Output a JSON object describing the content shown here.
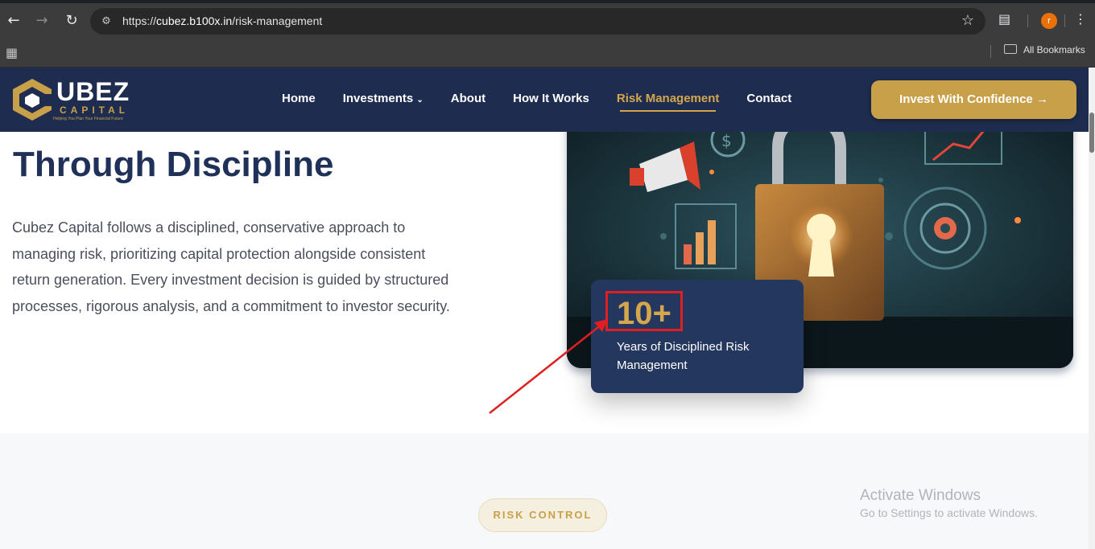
{
  "browser": {
    "url_prefix": "https://",
    "url_host": "cubez.b100x.in",
    "url_path": "/risk-management",
    "avatar_letter": "r",
    "bookmarks_label": "All Bookmarks"
  },
  "site": {
    "logo_word": "UBEZ",
    "logo_sub": "CAPITAL",
    "logo_tagline": "Helping You Plan Your Financial Future",
    "nav": [
      "Home",
      "Investments",
      "About",
      "How It Works",
      "Risk Management",
      "Contact"
    ],
    "active_nav": "Risk Management",
    "cta_label": "Invest With Confidence"
  },
  "hero": {
    "title_line": "Through Discipline",
    "description": "Cubez Capital follows a disciplined, conservative approach to managing risk, prioritizing capital protection alongside consistent return generation. Every investment decision is guided by structured processes, rigorous analysis, and a commitment to investor security.",
    "stat_value": "10+",
    "stat_label": "Years of Disciplined Risk Management"
  },
  "section_two": {
    "badge": "RISK CONTROL"
  },
  "os_overlay": {
    "line1": "Activate Windows",
    "line2": "Go to Settings to activate Windows."
  },
  "colors": {
    "header_bg": "#1e2d4f",
    "gold": "#c9a04a",
    "title_navy": "#1f3159",
    "annotation_red": "#e02020"
  }
}
